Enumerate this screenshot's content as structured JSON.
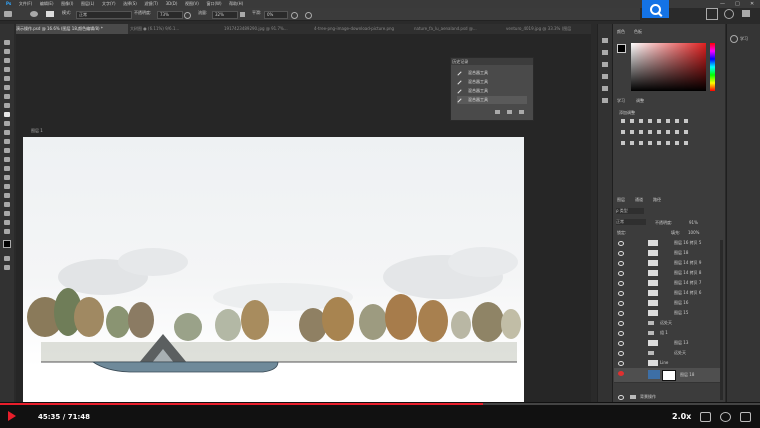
{
  "menubar": {
    "items": [
      "文件(F)",
      "编辑(E)",
      "图像(I)",
      "图层(L)",
      "文字(Y)",
      "选择(S)",
      "滤镜(T)",
      "3D(D)",
      "视图(V)",
      "窗口(W)",
      "帮助(H)"
    ],
    "minimize": "—",
    "maximize": "□",
    "close": "✕"
  },
  "options_bar": {
    "mode_label": "模式:",
    "mode_value": "正常",
    "opacity_label": "不透明度:",
    "opacity_value": "73%",
    "flow_label": "流量:",
    "flow_value": "32%",
    "smoothing_label": "平滑:",
    "smoothing_value": "0%"
  },
  "doc_tabs": [
    {
      "label": "演示操作.psd @ 16.6% (图层 18,颜色编辑/8) *",
      "active": true
    },
    {
      "label": "大树图 ● (6.11%) 9/6.1...",
      "active": false
    },
    {
      "label": "1917423489290.jpg @ 91.7%...",
      "active": false
    },
    {
      "label": "4-tree-png-image-download-picture.png",
      "active": false
    },
    {
      "label": "nature_fa_lu_aenaland.psd @...",
      "active": false
    },
    {
      "label": "venturo_4019.jpg @ 33.3% (图层",
      "active": false
    }
  ],
  "document_label": "图层 1",
  "history_panel": {
    "title": "历史记录",
    "rows": [
      "混合器工具",
      "混合器工具",
      "混合器工具",
      "混合器工具"
    ]
  },
  "right_panel": {
    "color_tabs": [
      "颜色",
      "色板"
    ],
    "adjust_tabs": [
      "学习",
      "调整"
    ],
    "adjust_title": "添加调整",
    "layers_tabs": [
      "图层",
      "通道",
      "路径"
    ],
    "filter_label": "ρ 类型",
    "blend_mode": "正常",
    "opacity_label": "不透明度:",
    "opacity_value": "91%",
    "lock_label": "锁定:",
    "fill_label": "填充:",
    "fill_value": "100%"
  },
  "layers": [
    {
      "name": "图层 16 拷贝 5"
    },
    {
      "name": "图层 18"
    },
    {
      "name": "图层 14 拷贝 9"
    },
    {
      "name": "图层 14 拷贝 8"
    },
    {
      "name": "图层 14 拷贝 7"
    },
    {
      "name": "图层 14 拷贝 6"
    },
    {
      "name": "图层 16"
    },
    {
      "name": "图层 15"
    },
    {
      "name": "远处天"
    },
    {
      "name": "组 1"
    },
    {
      "name": "图层 13"
    },
    {
      "name": "远处天"
    },
    {
      "name": "Line"
    },
    {
      "name": "图层 18"
    },
    {
      "name": "背景操作"
    }
  ],
  "learn_panel": {
    "label": "学习"
  },
  "player": {
    "current_time": "45:35",
    "total_time": "71:48",
    "time_separator": " / ",
    "progress": 0.635,
    "speed": "2.0x"
  },
  "colors": {
    "accent_red": "#e81e2b",
    "search_blue": "#1473e6"
  }
}
